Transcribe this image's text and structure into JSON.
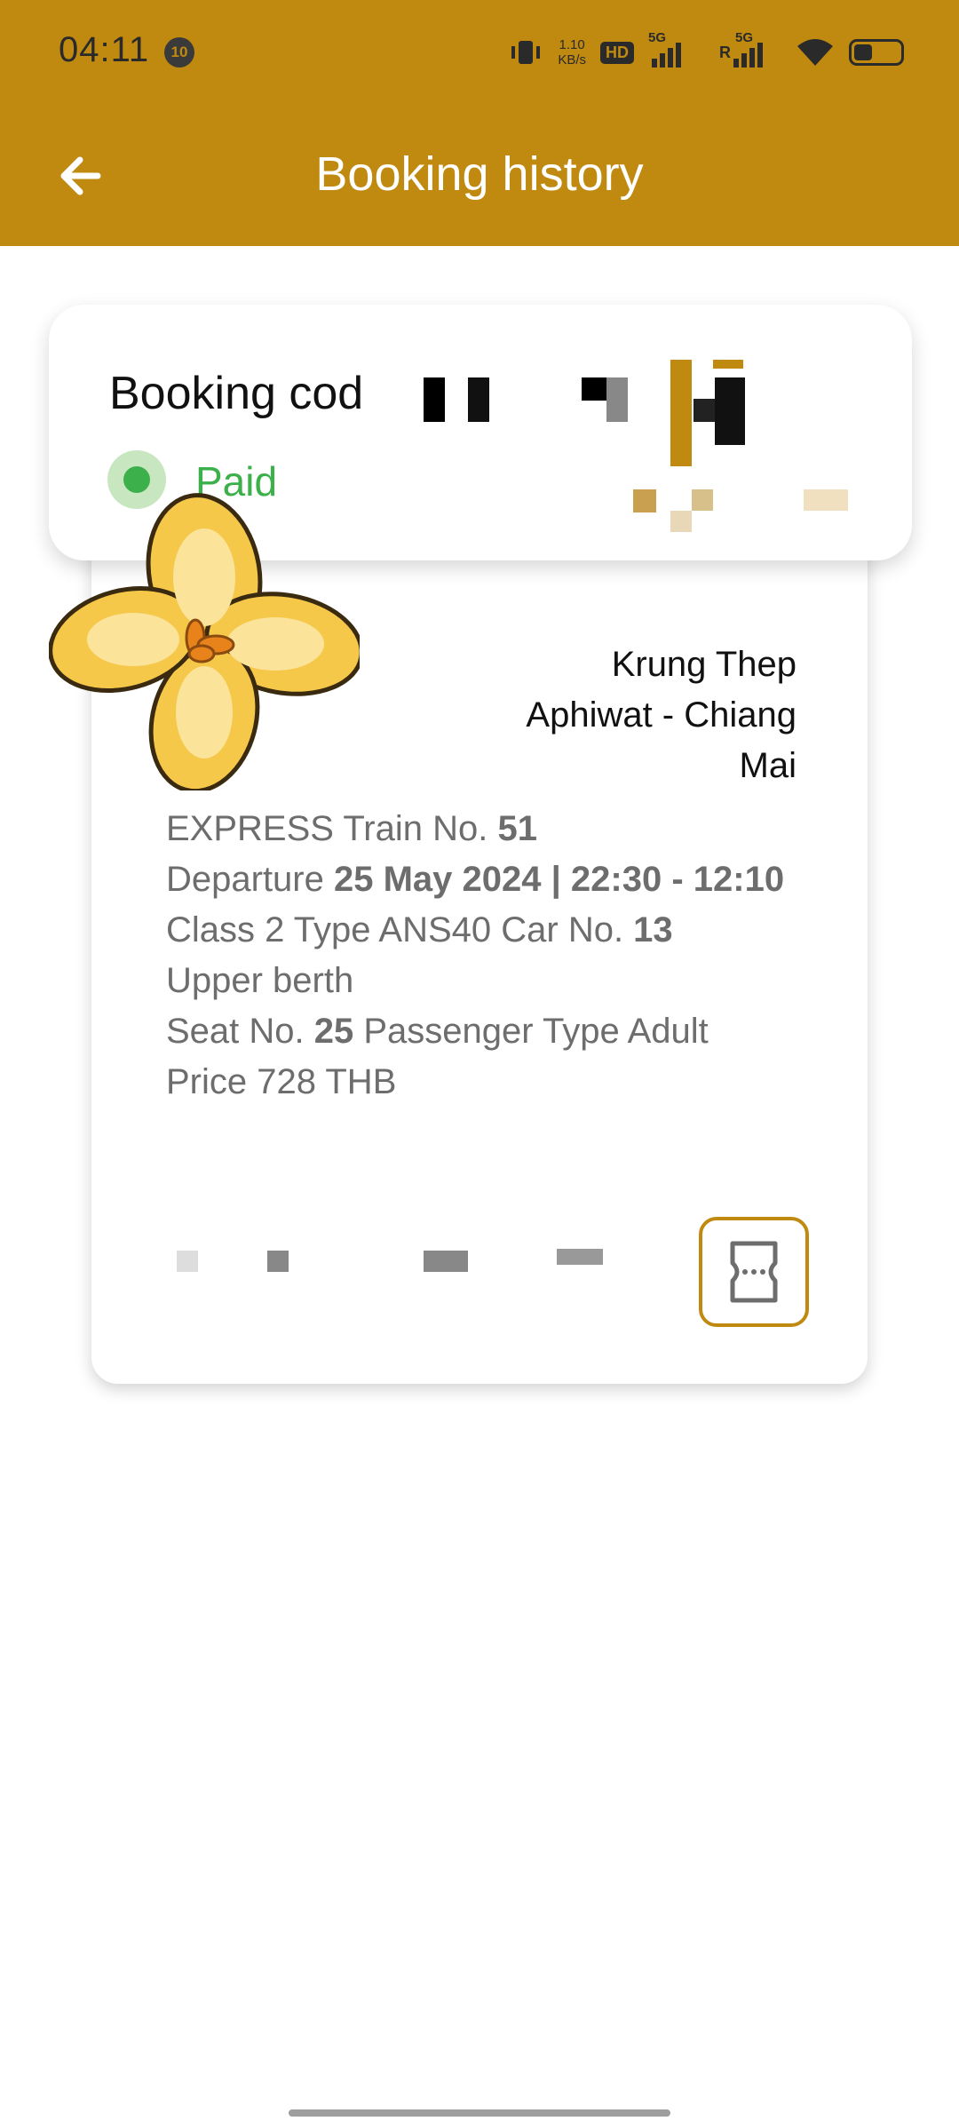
{
  "status_bar": {
    "time": "04:11",
    "notif_badge": "10",
    "net_speed_value": "1.10",
    "net_speed_unit": "KB/s",
    "hd_label": "HD",
    "sim1_label": "5G",
    "sim2_label": "5G",
    "roaming_label": "R"
  },
  "app_bar": {
    "title": "Booking history"
  },
  "booking": {
    "code_label": "Booking cod",
    "status": "Paid",
    "route_line1": "Krung Thep",
    "route_line2": "Aphiwat - Chiang",
    "route_line3": "Mai",
    "train_prefix": "EXPRESS Train No. ",
    "train_no": "51",
    "departure_prefix": "Departure ",
    "departure_value": "25 May 2024 | 22:30 - 12:10",
    "class_prefix": "Class 2 Type ANS40 Car No. ",
    "car_no": "13",
    "berth": "Upper berth",
    "seat_prefix": "Seat No. ",
    "seat_no": "25",
    "passenger_type": " Passenger Type Adult",
    "price": "Price 728 THB"
  },
  "colors": {
    "brand": "#c08a10",
    "paid_green": "#3cb04a"
  },
  "icons": [
    "back-arrow-icon",
    "ticket-icon",
    "vibrate-icon",
    "wifi-icon",
    "battery-icon"
  ]
}
